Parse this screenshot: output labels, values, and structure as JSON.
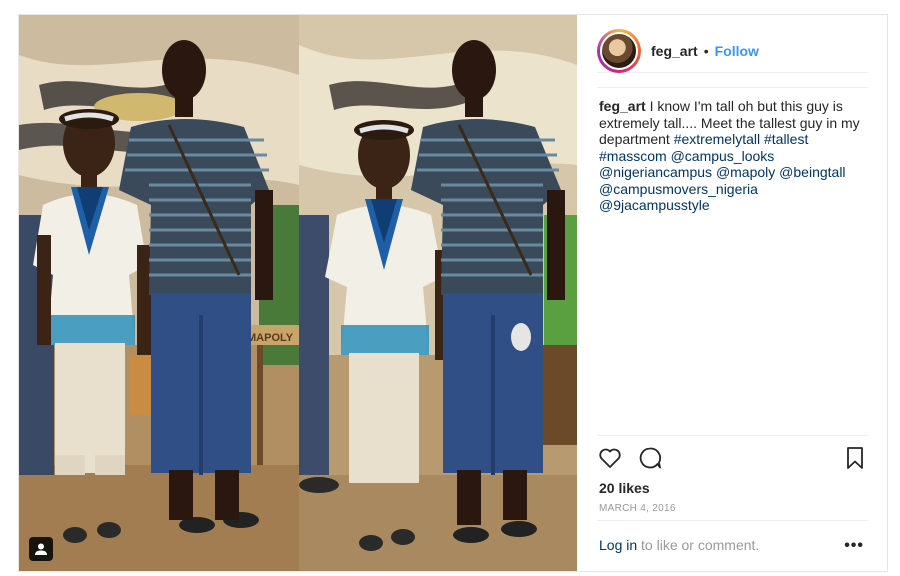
{
  "post": {
    "username": "feg_art",
    "separator": "•",
    "follow_label": "Follow",
    "caption": {
      "username": "feg_art",
      "text": "I know I'm tall oh but this guy is extremely tall.... Meet the tallest guy in my department",
      "tags": [
        "#extremelytall",
        "#tallest",
        "#masscom",
        "@campus_looks",
        "@nigeriancampus",
        "@mapoly",
        "@beingtall",
        "@campusmovers_nigeria",
        "@9jacampusstyle"
      ]
    },
    "likes": "20 likes",
    "date": "March 4, 2016",
    "footer": {
      "login_label": "Log in",
      "rest_text": "to like or comment.",
      "more_label": "•••"
    },
    "photo": {
      "desk_label": "MAPOLY"
    },
    "icons": {
      "like": "heart-icon",
      "comment": "comment-icon",
      "save": "bookmark-icon",
      "tagged_user": "person-icon",
      "options": "more-options-icon"
    },
    "colors": {
      "link_blue": "#3897f0",
      "tag_blue": "#003569",
      "muted": "#999999"
    }
  }
}
